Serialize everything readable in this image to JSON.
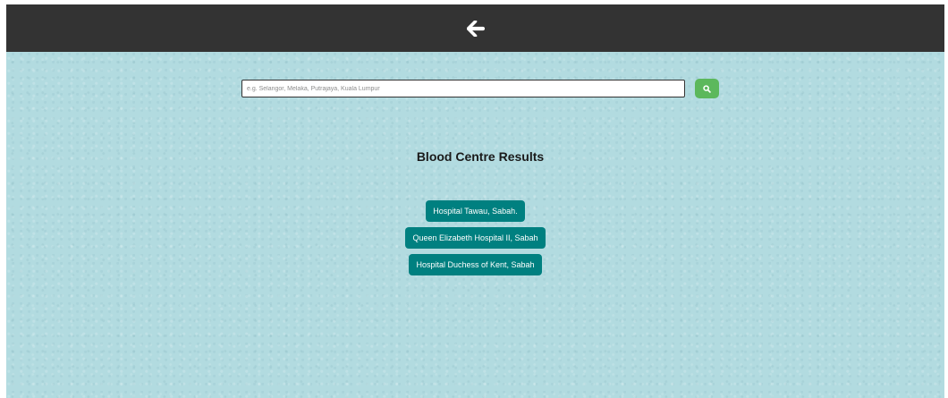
{
  "header": {
    "back_icon": "arrow-left-icon",
    "bar_color": "#333333"
  },
  "search": {
    "placeholder": "e.g. Selangor, Melaka, Putrajaya, Kuala Lumpur",
    "value": "",
    "button_icon": "search-icon",
    "button_color": "#5cb85c"
  },
  "main": {
    "title": "Blood Centre Results",
    "background_color": "#b2dbe0",
    "results": [
      {
        "label": "Hospital Tawau, Sabah."
      },
      {
        "label": "Queen Elizabeth Hospital II, Sabah"
      },
      {
        "label": "Hospital Duchess of Kent, Sabah"
      }
    ],
    "result_button_color": "#008080"
  }
}
